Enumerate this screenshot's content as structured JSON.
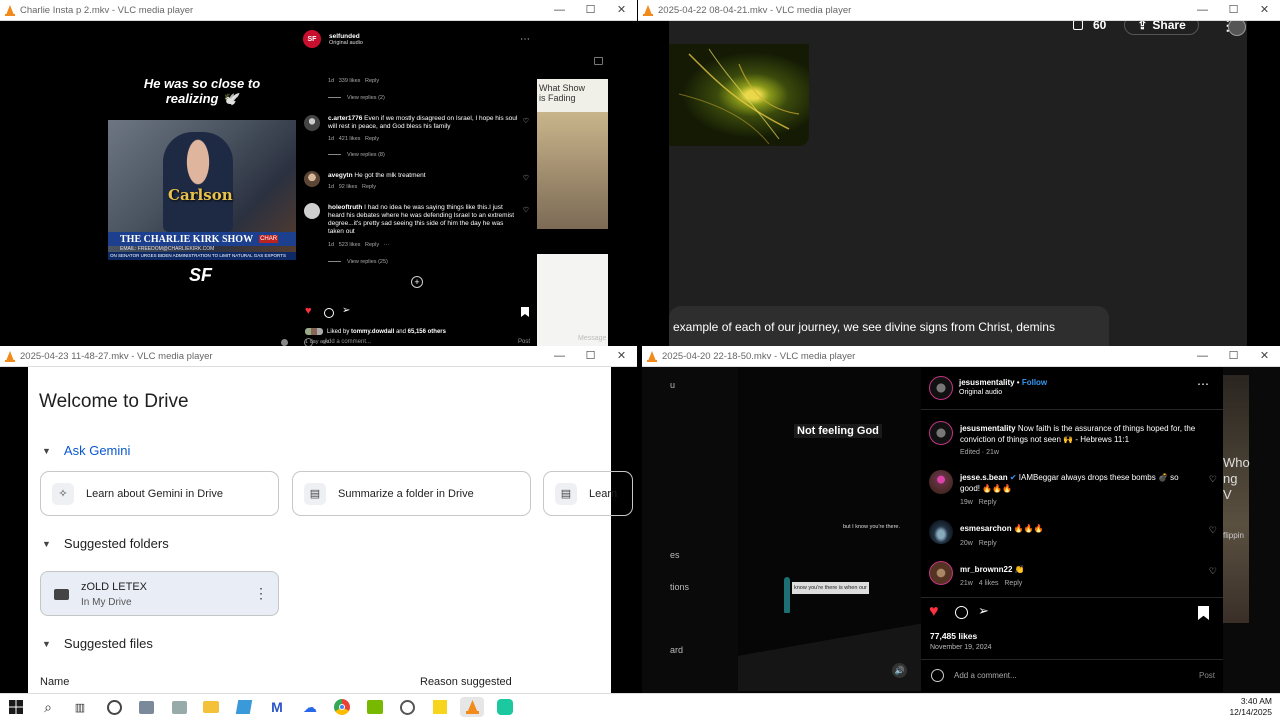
{
  "windows": {
    "w1": {
      "title": "Charlie Insta p 2.mkv - VLC media player"
    },
    "w2": {
      "title": "2025-04-22 08-04-21.mkv - VLC media player"
    },
    "w3": {
      "title": "2025-04-23 11-48-27.mkv - VLC media player"
    },
    "w4": {
      "title": "2025-04-20 22-18-50.mkv - VLC media player"
    }
  },
  "w1": {
    "caption": "He was so close to realizing 🕊️",
    "lower_third": "Carlson",
    "banner": "THE CHARLIE KIRK SHOW",
    "banner_small": "CHAR",
    "email": "EMAIL: FREEDOM@CHARLIEKIRK.COM",
    "ticker": "ON SENATOR URGES BIDEN ADMINISTRATION TO LIMIT NATURAL GAS EXPORTS",
    "sf_logo": "SF",
    "right_video": "What Show\nis Fading",
    "message_btn": "Message",
    "ig": {
      "account": "selfunded",
      "audio": "Original audio",
      "avatar_text": "SF",
      "c0_meta": {
        "time": "1d",
        "likes": "339 likes",
        "reply": "Reply"
      },
      "c0_view": "View replies (2)",
      "c1": {
        "user": "c.arter1776",
        "text": "Even if we mostly disagreed on Israel, I hope his soul will rest in peace, and God bless his family",
        "time": "1d",
        "likes": "421 likes",
        "reply": "Reply",
        "view": "View replies (8)"
      },
      "c2": {
        "user": "avegytn",
        "text": "He got the mlk treatment",
        "time": "1d",
        "likes": "92 likes",
        "reply": "Reply"
      },
      "c3": {
        "user": "holeoftruth",
        "text": "I had no idea he was saying things like this.I just heard his debates where he was defending Israel to an extremist degree...it's pretty sad seeing this side of him the day he was taken out",
        "time": "1d",
        "likes": "523 likes",
        "reply": "Reply",
        "more": "···",
        "view": "View replies (25)"
      },
      "liked_by": "Liked by",
      "liked_user": "tommy.dowdall",
      "liked_and": "and",
      "liked_others": "65,156 others",
      "date": "1 day ago",
      "add_comment": "Add a comment...",
      "post": "Post"
    }
  },
  "w2": {
    "count": "60",
    "share": "Share",
    "subtitle": "example of each of our journey, we see divine signs from Christ, demins"
  },
  "w3": {
    "welcome": "Welcome to Drive",
    "ask_gemini": "Ask Gemini",
    "chips": [
      "Learn about Gemini in Drive",
      "Summarize a folder in Drive",
      "Learn"
    ],
    "suggested_folders": "Suggested folders",
    "folder_name": "zOLD LETEX",
    "folder_loc": "In My Drive",
    "suggested_files": "Suggested files",
    "col_name": "Name",
    "col_reason": "Reason suggested"
  },
  "w4": {
    "overlay1": "Not feeling God",
    "overlay2": "but I know you're there.",
    "overlay3": "know you're there is when our",
    "left_frags": [
      "u",
      "es",
      "tions",
      "ard"
    ],
    "right_frag": "Who\nng V",
    "right_frag2": "flippin",
    "ig": {
      "account": "jesusmentality",
      "follow": "Follow",
      "audio": "Original audio",
      "caption_user": "jesusmentality",
      "caption": "Now faith is the assurance of things hoped for, the conviction of things not seen 🙌 - Hebrews 11:1",
      "caption_meta": "Edited · 21w",
      "c1": {
        "user": "jesse.s.bean",
        "text": "IAMBeggar always drops these bombs 💣 so good! 🔥🔥🔥",
        "time": "19w",
        "reply": "Reply"
      },
      "c2": {
        "user": "esmesarchon",
        "text": "🔥🔥🔥",
        "time": "20w",
        "reply": "Reply"
      },
      "c3": {
        "user": "mr_brownn22",
        "text": "👏",
        "time": "21w",
        "likes": "4 likes",
        "reply": "Reply"
      },
      "likes": "77,485 likes",
      "date": "November 19, 2024",
      "add_comment": "Add a comment...",
      "post": "Post"
    }
  },
  "taskbar": {
    "time": "3:40 AM",
    "date": "12/14/2025"
  },
  "colors": {
    "vlc_orange": "#f28a1c",
    "ig_red": "#ff3040",
    "ig_blue": "#3897f0",
    "drive_blue": "#0b57d0"
  }
}
